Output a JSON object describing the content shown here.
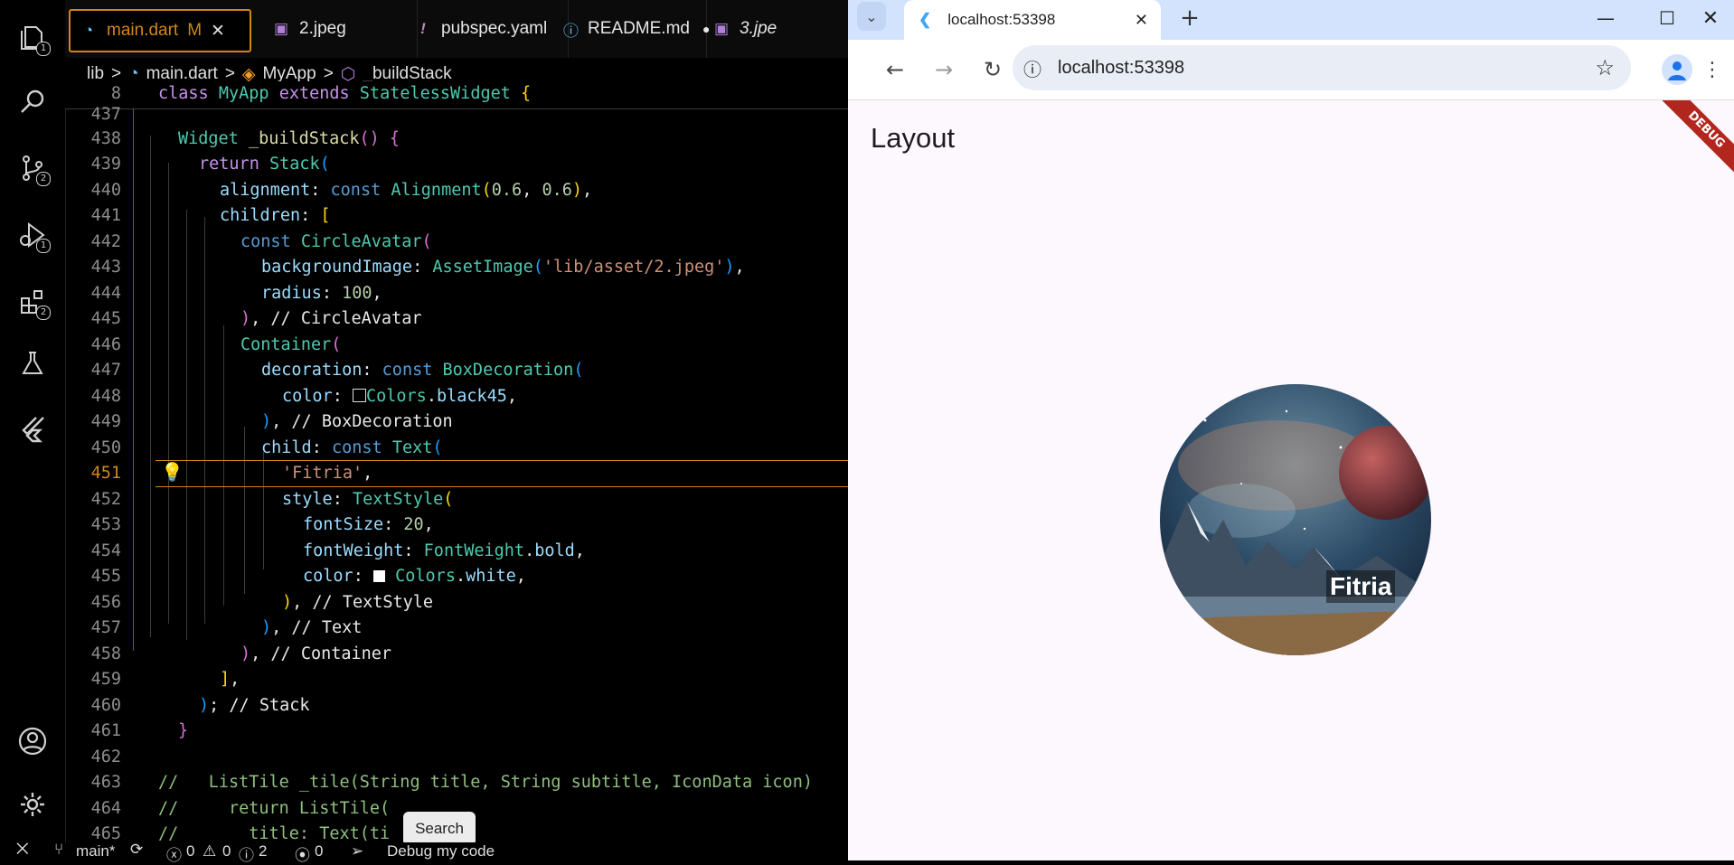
{
  "editor": {
    "tabs": [
      {
        "label": "main.dart",
        "suffix": "M",
        "close": "✕"
      },
      {
        "label": "2.jpeg"
      },
      {
        "label": "pubspec.yaml"
      },
      {
        "label": "README.md",
        "dot": "●"
      },
      {
        "label": "3.jpe"
      }
    ],
    "breadcrumb": [
      "lib",
      ">",
      "main.dart",
      ">",
      "MyApp",
      ">",
      "_buildStack"
    ],
    "sticky_line_number": "8",
    "sticky_line": "class MyApp extends StatelessWidget {",
    "line_numbers": [
      "437",
      "438",
      "439",
      "440",
      "441",
      "442",
      "443",
      "444",
      "445",
      "446",
      "447",
      "448",
      "449",
      "450",
      "451",
      "452",
      "453",
      "454",
      "455",
      "456",
      "457",
      "458",
      "459",
      "460",
      "461",
      "462",
      "463",
      "464",
      "465"
    ],
    "tooltip": "Search",
    "activity_badges": [
      "1",
      "2",
      "1",
      "2"
    ]
  },
  "status": {
    "branch": "main*",
    "errors": "0",
    "warnings": "0",
    "info": "2",
    "ports": "0",
    "debug": "Debug my code"
  },
  "browser": {
    "tab_title": "localhost:53398",
    "url": "localhost:53398",
    "app_title": "Layout",
    "debug_banner": "DEBUG",
    "avatar_text": "Fitria"
  }
}
